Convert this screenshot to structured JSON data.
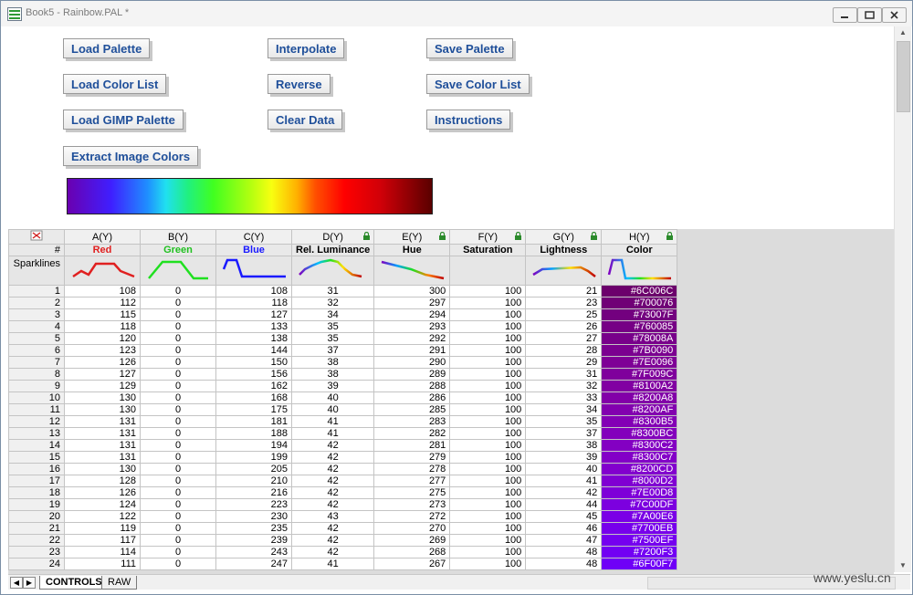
{
  "window": {
    "title": "Book5 - Rainbow.PAL *"
  },
  "buttons": {
    "load_palette": "Load Palette",
    "load_color_list": "Load Color List",
    "load_gimp_palette": "Load GIMP Palette",
    "extract_image_colors": "Extract Image Colors",
    "interpolate": "Interpolate",
    "reverse": "Reverse",
    "clear_data": "Clear Data",
    "save_palette": "Save Palette",
    "save_color_list": "Save Color List",
    "instructions": "Instructions"
  },
  "sheet": {
    "columns": [
      "A(Y)",
      "B(Y)",
      "C(Y)",
      "D(Y)",
      "E(Y)",
      "F(Y)",
      "G(Y)",
      "H(Y)"
    ],
    "long_names": [
      "Red",
      "Green",
      "Blue",
      "Rel. Luminance",
      "Hue",
      "Saturation",
      "Lightness",
      "Color"
    ],
    "long_name_colors": [
      "#e02020",
      "#20c020",
      "#1a1aff",
      "#000000",
      "#000000",
      "#000000",
      "#000000",
      "#000000"
    ],
    "row_label_name": "#",
    "row_label_sparklines": "Sparklines",
    "rows": [
      [
        "1",
        "108",
        "0",
        "108",
        "31",
        "300",
        "100",
        "21",
        "#6C006C"
      ],
      [
        "2",
        "112",
        "0",
        "118",
        "32",
        "297",
        "100",
        "23",
        "#700076"
      ],
      [
        "3",
        "115",
        "0",
        "127",
        "34",
        "294",
        "100",
        "25",
        "#73007F"
      ],
      [
        "4",
        "118",
        "0",
        "133",
        "35",
        "293",
        "100",
        "26",
        "#760085"
      ],
      [
        "5",
        "120",
        "0",
        "138",
        "35",
        "292",
        "100",
        "27",
        "#78008A"
      ],
      [
        "6",
        "123",
        "0",
        "144",
        "37",
        "291",
        "100",
        "28",
        "#7B0090"
      ],
      [
        "7",
        "126",
        "0",
        "150",
        "38",
        "290",
        "100",
        "29",
        "#7E0096"
      ],
      [
        "8",
        "127",
        "0",
        "156",
        "38",
        "289",
        "100",
        "31",
        "#7F009C"
      ],
      [
        "9",
        "129",
        "0",
        "162",
        "39",
        "288",
        "100",
        "32",
        "#8100A2"
      ],
      [
        "10",
        "130",
        "0",
        "168",
        "40",
        "286",
        "100",
        "33",
        "#8200A8"
      ],
      [
        "11",
        "130",
        "0",
        "175",
        "40",
        "285",
        "100",
        "34",
        "#8200AF"
      ],
      [
        "12",
        "131",
        "0",
        "181",
        "41",
        "283",
        "100",
        "35",
        "#8300B5"
      ],
      [
        "13",
        "131",
        "0",
        "188",
        "41",
        "282",
        "100",
        "37",
        "#8300BC"
      ],
      [
        "14",
        "131",
        "0",
        "194",
        "42",
        "281",
        "100",
        "38",
        "#8300C2"
      ],
      [
        "15",
        "131",
        "0",
        "199",
        "42",
        "279",
        "100",
        "39",
        "#8300C7"
      ],
      [
        "16",
        "130",
        "0",
        "205",
        "42",
        "278",
        "100",
        "40",
        "#8200CD"
      ],
      [
        "17",
        "128",
        "0",
        "210",
        "42",
        "277",
        "100",
        "41",
        "#8000D2"
      ],
      [
        "18",
        "126",
        "0",
        "216",
        "42",
        "275",
        "100",
        "42",
        "#7E00D8"
      ],
      [
        "19",
        "124",
        "0",
        "223",
        "42",
        "273",
        "100",
        "44",
        "#7C00DF"
      ],
      [
        "20",
        "122",
        "0",
        "230",
        "43",
        "272",
        "100",
        "45",
        "#7A00E6"
      ],
      [
        "21",
        "119",
        "0",
        "235",
        "42",
        "270",
        "100",
        "46",
        "#7700EB"
      ],
      [
        "22",
        "117",
        "0",
        "239",
        "42",
        "269",
        "100",
        "47",
        "#7500EF"
      ],
      [
        "23",
        "114",
        "0",
        "243",
        "42",
        "268",
        "100",
        "48",
        "#7200F3"
      ],
      [
        "24",
        "111",
        "0",
        "247",
        "41",
        "267",
        "100",
        "48",
        "#6F00F7"
      ]
    ]
  },
  "tabs": {
    "controls": "CONTROLS",
    "raw": "RAW"
  },
  "watermark": "www.yeslu.cn"
}
